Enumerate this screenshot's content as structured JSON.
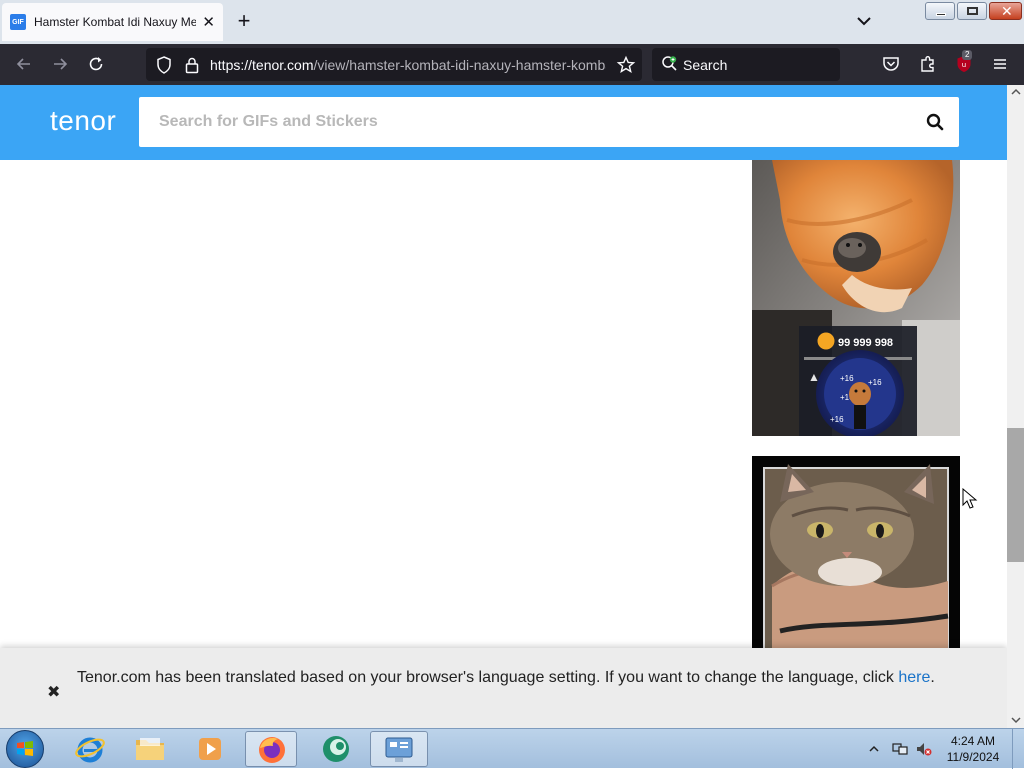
{
  "browser": {
    "tab_title": "Hamster Kombat Idi Naxuy Meme",
    "tab_favicon_label": "GIF",
    "url_host": "https://tenor.com",
    "url_path": "/view/hamster-kombat-idi-naxuy-hamster-kombat-gif",
    "search_label": "Search",
    "extension_badge": "2"
  },
  "tenor": {
    "logo": "tenor",
    "search_placeholder": "Search for GIFs and Stickers"
  },
  "gif1": {
    "coin_count": "99 999 998",
    "tap_labels": [
      "+16",
      "+16",
      "+16",
      "+16"
    ]
  },
  "banner": {
    "close_glyph": "✖",
    "text": "Tenor.com has been translated based on your browser's language setting. If you want to change the language, click ",
    "link": "here",
    "suffix": "."
  },
  "taskbar": {
    "time": "4:24 AM",
    "date": "11/9/2024"
  },
  "colors": {
    "tenor_blue": "#3ba5f5",
    "firefox_toolbar": "#2b2a33",
    "link": "#1a73c8"
  }
}
